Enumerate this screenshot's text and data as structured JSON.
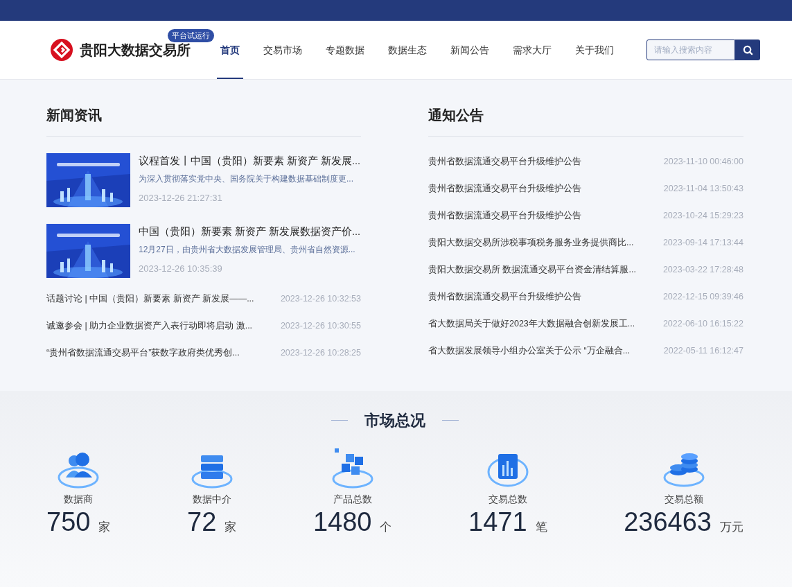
{
  "header": {
    "logo_title": "贵阳大数据交易所",
    "badge": "平台试运行",
    "nav": [
      {
        "label": "首页",
        "selected": true
      },
      {
        "label": "交易市场",
        "selected": false
      },
      {
        "label": "专题数据",
        "selected": false
      },
      {
        "label": "数据生态",
        "selected": false
      },
      {
        "label": "新闻公告",
        "selected": false
      },
      {
        "label": "需求大厅",
        "selected": false
      },
      {
        "label": "关于我们",
        "selected": false
      }
    ],
    "search": {
      "placeholder": "请输入搜索内容"
    }
  },
  "news": {
    "title": "新闻资讯",
    "featured": [
      {
        "kind": "picture",
        "title": "议程首发丨中国（贵阳）新要素 新资产 新发展...",
        "summary": "为深入贯彻落实党中央、国务院关于构建数据基础制度更...",
        "date": "2023-12-26 21:27:31"
      },
      {
        "kind": "picture",
        "title": "中国（贵阳）新要素 新资产 新发展数据资产价...",
        "summary": "12月27日，由贵州省大数据发展管理局、贵州省自然资源...",
        "date": "2023-12-26 10:35:39"
      }
    ],
    "items": [
      {
        "title": "话题讨论 | 中国（贵阳）新要素 新资产 新发展——...",
        "date": "2023-12-26 10:32:53"
      },
      {
        "title": "诚邀参会 | 助力企业数据资产入表行动即将启动 激...",
        "date": "2023-12-26 10:30:55"
      },
      {
        "title": "“贵州省数据流通交易平台”获数字政府类优秀创...",
        "date": "2023-12-26 10:28:25"
      }
    ]
  },
  "notices": {
    "title": "通知公告",
    "items": [
      {
        "title": "贵州省数据流通交易平台升级维护公告",
        "date": "2023-11-10 00:46:00"
      },
      {
        "title": "贵州省数据流通交易平台升级维护公告",
        "date": "2023-11-04 13:50:43"
      },
      {
        "title": "贵州省数据流通交易平台升级维护公告",
        "date": "2023-10-24 15:29:23"
      },
      {
        "title": "贵阳大数据交易所涉税事项税务服务业务提供商比...",
        "date": "2023-09-14 17:13:44"
      },
      {
        "title": "贵阳大数据交易所 数据流通交易平台资金清结算服...",
        "date": "2023-03-22 17:28:48"
      },
      {
        "title": "贵州省数据流通交易平台升级维护公告",
        "date": "2022-12-15 09:39:46"
      },
      {
        "title": "省大数据局关于做好2023年大数据融合创新发展工...",
        "date": "2022-06-10 16:15:22"
      },
      {
        "title": "省大数据发展领导小组办公室关于公示 “万企融合...",
        "date": "2022-05-11 16:12:47"
      }
    ]
  },
  "market": {
    "title": "市场总况",
    "stats": [
      {
        "label": "数据商",
        "value": "750",
        "unit": "家"
      },
      {
        "label": "数据中介",
        "value": "72",
        "unit": "家"
      },
      {
        "label": "产品总数",
        "value": "1480",
        "unit": "个"
      },
      {
        "label": "交易总数",
        "value": "1471",
        "unit": "笔"
      },
      {
        "label": "交易总额",
        "value": "236463",
        "unit": "万元"
      }
    ]
  }
}
